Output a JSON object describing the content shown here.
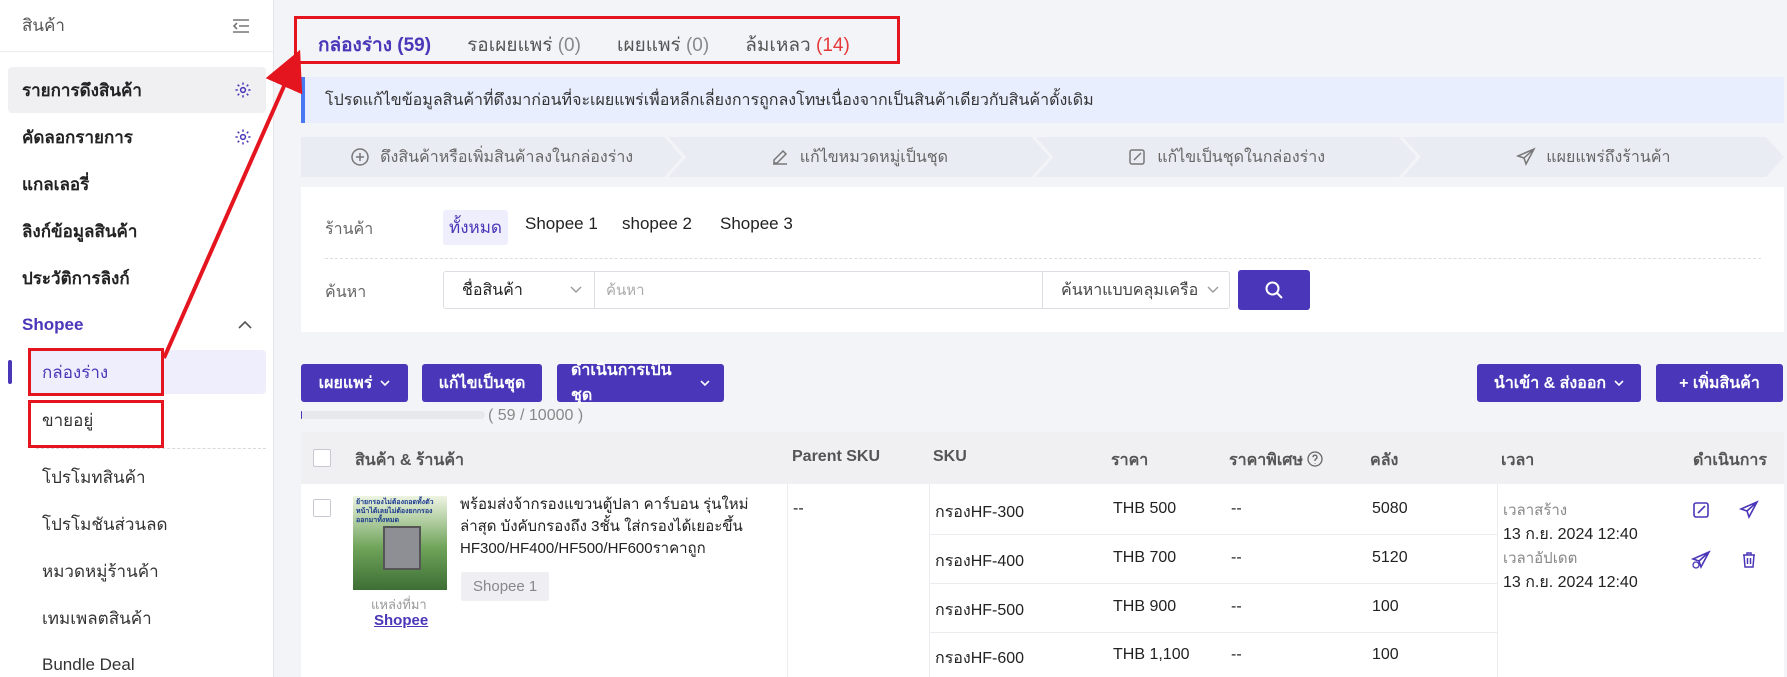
{
  "sidebar": {
    "header": "สินค้า",
    "items": [
      {
        "label": "รายการดึงสินค้า"
      },
      {
        "label": "คัดลอกรายการ"
      },
      {
        "label": "แกลเลอรี่"
      },
      {
        "label": "ลิงก์ข้อมูลสินค้า"
      },
      {
        "label": "ประวัติการลิงก์"
      },
      {
        "label": "Shopee"
      }
    ],
    "subitems": [
      {
        "label": "กล่องร่าง"
      },
      {
        "label": "ขายอยู่"
      },
      {
        "label": "โปรโมทสินค้า"
      },
      {
        "label": "โปรโมชันส่วนลด"
      },
      {
        "label": "หมวดหมู่ร้านค้า"
      },
      {
        "label": "เทมเพลตสินค้า"
      },
      {
        "label": "Bundle Deal"
      }
    ]
  },
  "tabs": [
    {
      "label": "กล่องร่าง",
      "count": "(59)"
    },
    {
      "label": "รอเผยแพร่",
      "count": "(0)"
    },
    {
      "label": "เผยแพร่",
      "count": "(0)"
    },
    {
      "label": "ล้มเหลว",
      "count": "(14)"
    }
  ],
  "notice": "โปรดแก้ไขข้อมูลสินค้าที่ดึงมาก่อนที่จะเผยแพร่เพื่อหลีกเลี่ยงการถูกลงโทษเนื่องจากเป็นสินค้าเดียวกับสินค้าดั้งเดิม",
  "steps": [
    {
      "label": "ดึงสินค้าหรือเพิ่มสินค้าลงในกล่องร่าง",
      "icon": "plus-circle-icon"
    },
    {
      "label": "แก้ไขหมวดหมู่เป็นชุด",
      "icon": "edit-icon"
    },
    {
      "label": "แก้ไขเป็นชุดในกล่องร่าง",
      "icon": "edit-icon"
    },
    {
      "label": "แผยแพร่ถึงร้านค้า",
      "icon": "send-icon"
    }
  ],
  "filter": {
    "shop_label": "ร้านค้า",
    "shops": [
      "ทั้งหมด",
      "Shopee 1",
      "shopee 2",
      "Shopee 3"
    ],
    "search_label": "ค้นหา",
    "field_select": "ชื่อสินค้า",
    "search_placeholder": "ค้นหา",
    "mode_select": "ค้นหาแบบคลุมเครือ"
  },
  "actions": {
    "publish": "เผยแพร่",
    "bulk_edit": "แก้ไขเป็นชุด",
    "bulk_ops": "ดำเนินการเป็นชุด",
    "import_export": "นำเข้า & ส่งออก",
    "add_product": "+ เพิ่มสินค้า"
  },
  "quota": {
    "text": "( 59 / 10000 )",
    "fraction": 0.0059
  },
  "table": {
    "headers": [
      "สินค้า & ร้านค้า",
      "Parent SKU",
      "SKU",
      "ราคา",
      "ราคาพิเศษ",
      "คลัง",
      "เวลา",
      "ดำเนินการ"
    ],
    "row": {
      "title": "พร้อมส่งจ้ากรองแขวนตู้ปลา คาร์บอน รุ่นใหม่ล่าสุด บังคับกรองถึง 3ชั้น ใส่กรองได้เยอะขึ้น HF300/HF400/HF500/HF600ราคาถูก",
      "thumb_caption": "ย้ายกรองไม่ต้องถอดทั้งตัวหน้าได้เลยไม่ต้องยกกรองออกมาทั้งหมด",
      "shop": "Shopee 1",
      "source_label": "แหล่งที่มา",
      "source_link": "Shopee",
      "parent_sku": "--",
      "variants": [
        {
          "sku": "กรองHF-300",
          "price": "THB 500",
          "special": "--",
          "stock": "5080"
        },
        {
          "sku": "กรองHF-400",
          "price": "THB 700",
          "special": "--",
          "stock": "5120"
        },
        {
          "sku": "กรองHF-500",
          "price": "THB 900",
          "special": "--",
          "stock": "100"
        },
        {
          "sku": "กรองHF-600",
          "price": "THB 1,100",
          "special": "--",
          "stock": "100"
        }
      ],
      "created_label": "เวลาสร้าง",
      "created": "13 ก.ย. 2024 12:40",
      "updated_label": "เวลาอัปเดต",
      "updated": "13 ก.ย. 2024 12:40"
    }
  },
  "colors": {
    "accent": "#4a36b8",
    "annotation": "#e4151f",
    "failed": "#e53939"
  }
}
